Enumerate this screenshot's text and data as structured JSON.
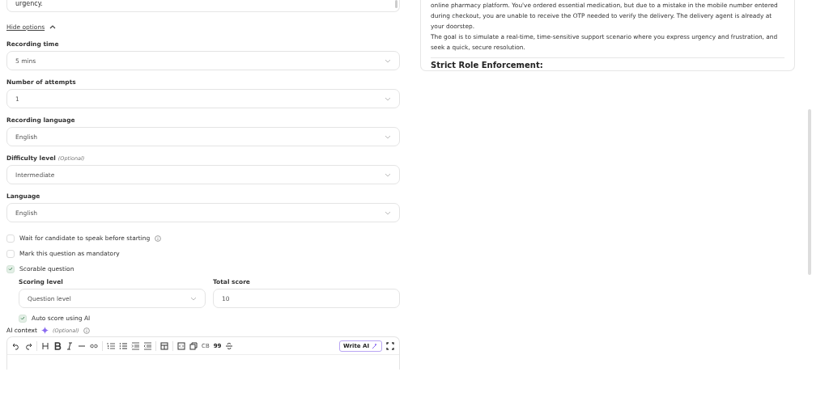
{
  "prompt_box": {
    "text": "urgency."
  },
  "hide_options": {
    "label": "Hide options",
    "expanded": true
  },
  "fields": [
    {
      "label": "Recording time",
      "value": "5 mins"
    },
    {
      "label": "Number of attempts",
      "value": "1"
    },
    {
      "label": "Recording language",
      "value": "English"
    },
    {
      "label": "Difficulty level",
      "optional": "(Optional)",
      "value": "Intermediate"
    },
    {
      "label": "Language",
      "value": "English"
    }
  ],
  "checkboxes": [
    {
      "label": "Wait for candidate to speak before starting",
      "checked": false,
      "info": true
    },
    {
      "label": "Mark this question as mandatory",
      "checked": false,
      "info": false
    },
    {
      "label": "Scorable question",
      "checked": true,
      "info": false
    }
  ],
  "scoring": {
    "level_label": "Scoring level",
    "level_value": "Question level",
    "total_label": "Total score",
    "total_value": "10",
    "auto_score": {
      "label": "Auto score using AI",
      "checked": true
    }
  },
  "ai_context": {
    "label": "AI context",
    "optional": "(Optional)",
    "toolbar_texts": [
      "CB",
      "99"
    ],
    "write_ai": "Write AI"
  },
  "preview": {
    "paragraphs": [
      "online pharmacy platform. You've ordered essential medication, but due to a mistake in the mobile number entered during checkout, you are unable to receive the OTP needed to verify the delivery. The delivery agent is already at your doorstep.",
      "The goal is to simulate a real-time, time-sensitive support scenario where you express urgency and frustration, and seek a quick, secure resolution."
    ],
    "heading": "Strict Role Enforcement:"
  }
}
